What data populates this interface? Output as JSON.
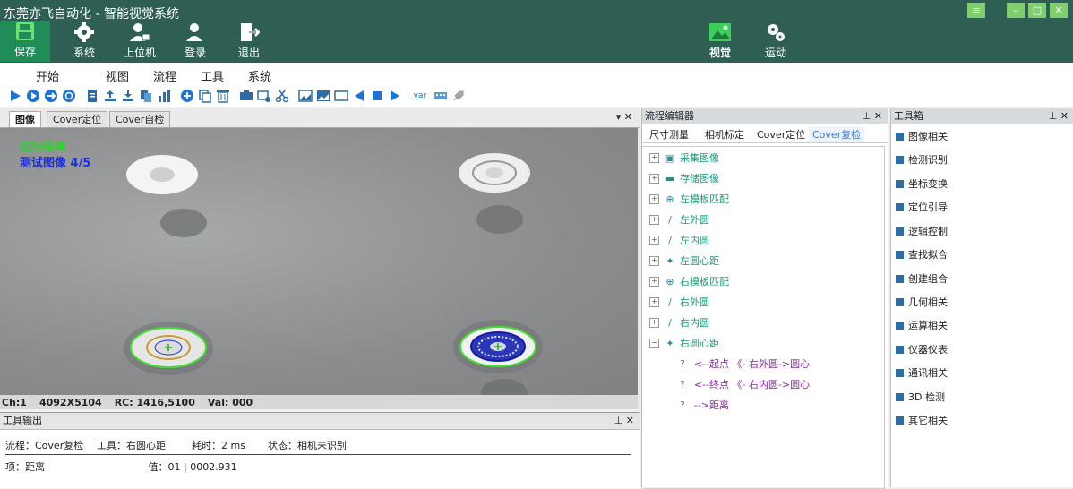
{
  "window": {
    "title": "东莞亦飞自动化 - 智能视觉系统",
    "controls": [
      "≡",
      "–",
      "□",
      "✕"
    ]
  },
  "header": {
    "buttons": [
      {
        "label": "保存",
        "icon": "save-icon"
      },
      {
        "label": "系统",
        "icon": "gear-icon"
      },
      {
        "label": "上位机",
        "icon": "user-lock-icon"
      },
      {
        "label": "登录",
        "icon": "login-user-icon"
      },
      {
        "label": "退出",
        "icon": "exit-icon"
      },
      {
        "label": "视觉",
        "icon": "image-icon"
      },
      {
        "label": "运动",
        "icon": "motion-gear-icon"
      }
    ]
  },
  "menu": [
    "开始",
    "视图",
    "流程",
    "工具",
    "系统"
  ],
  "toolbar": {
    "var_label": "var",
    "icons": [
      "run-icon",
      "run-once-icon",
      "run-next-icon",
      "refresh-icon",
      "new-file-icon",
      "export-icon",
      "import-icon",
      "copy-flow-icon",
      "stats-icon",
      "add-icon",
      "copy-icon",
      "delete-icon",
      "camera-icon",
      "settings-tool-icon",
      "scissors-icon",
      "image-icon",
      "image-open-icon",
      "window-icon",
      "prev-icon",
      "stop-icon",
      "next-icon",
      "var-icon",
      "keyboard-icon",
      "rocket-icon"
    ]
  },
  "image_panel": {
    "tabs": [
      "图像",
      "Cover定位",
      "Cover自检"
    ],
    "controls": "▾ ✕",
    "overlay_line1": "运行结果",
    "overlay_line2": "测试图像  4/5",
    "status": {
      "channel": "Ch:1",
      "size": "4092X5104",
      "rc": "RC: 1416,5100",
      "val": "Val: 000"
    }
  },
  "tool_output": {
    "title": "工具输出",
    "controls": "⊥ ✕",
    "row1": {
      "flow": "流程：Cover复检",
      "tool": "工具：右圆心距",
      "time": "耗时：2 ms",
      "state": "状态：相机未识别"
    },
    "row2": {
      "item": "项：距离",
      "value": "值：01 |   0002.931"
    }
  },
  "flow_editor": {
    "title": "流程编辑器",
    "controls": "⊥ ✕",
    "tabs": [
      "尺寸测量",
      "相机标定",
      "Cover定位",
      "Cover复检"
    ],
    "nodes": [
      {
        "label": "采集图像",
        "icon": "camera-icon",
        "exp": "+"
      },
      {
        "label": "存储图像",
        "icon": "save-icon",
        "exp": "+"
      },
      {
        "label": "左模板匹配",
        "icon": "zoom-icon",
        "exp": "+"
      },
      {
        "label": "左外圆",
        "icon": "line-icon",
        "exp": "+"
      },
      {
        "label": "左内圆",
        "icon": "line-icon",
        "exp": "+"
      },
      {
        "label": "左圆心距",
        "icon": "pin-icon",
        "exp": "+"
      },
      {
        "label": "右模板匹配",
        "icon": "zoom-icon",
        "exp": "+"
      },
      {
        "label": "右外圆",
        "icon": "line-icon",
        "exp": "+"
      },
      {
        "label": "右内圆",
        "icon": "line-icon",
        "exp": "+"
      },
      {
        "label": "右圆心距",
        "icon": "pin-icon",
        "exp": "−"
      }
    ],
    "children": [
      {
        "q": "?",
        "label": "<--起点 《- 右外圆->圆心"
      },
      {
        "q": "?",
        "label": "<--终点 《- 右内圆->圆心"
      },
      {
        "q": "?",
        "label": "-->距离"
      }
    ]
  },
  "toolbox": {
    "title": "工具箱",
    "controls": "⊥ ✕",
    "items": [
      "图像相关",
      "检测识别",
      "坐标变换",
      "定位引导",
      "逻辑控制",
      "查找拟合",
      "创建组合",
      "几何相关",
      "运算相关",
      "仪器仪表",
      "通讯相关",
      "3D  检测",
      "其它相关"
    ]
  }
}
